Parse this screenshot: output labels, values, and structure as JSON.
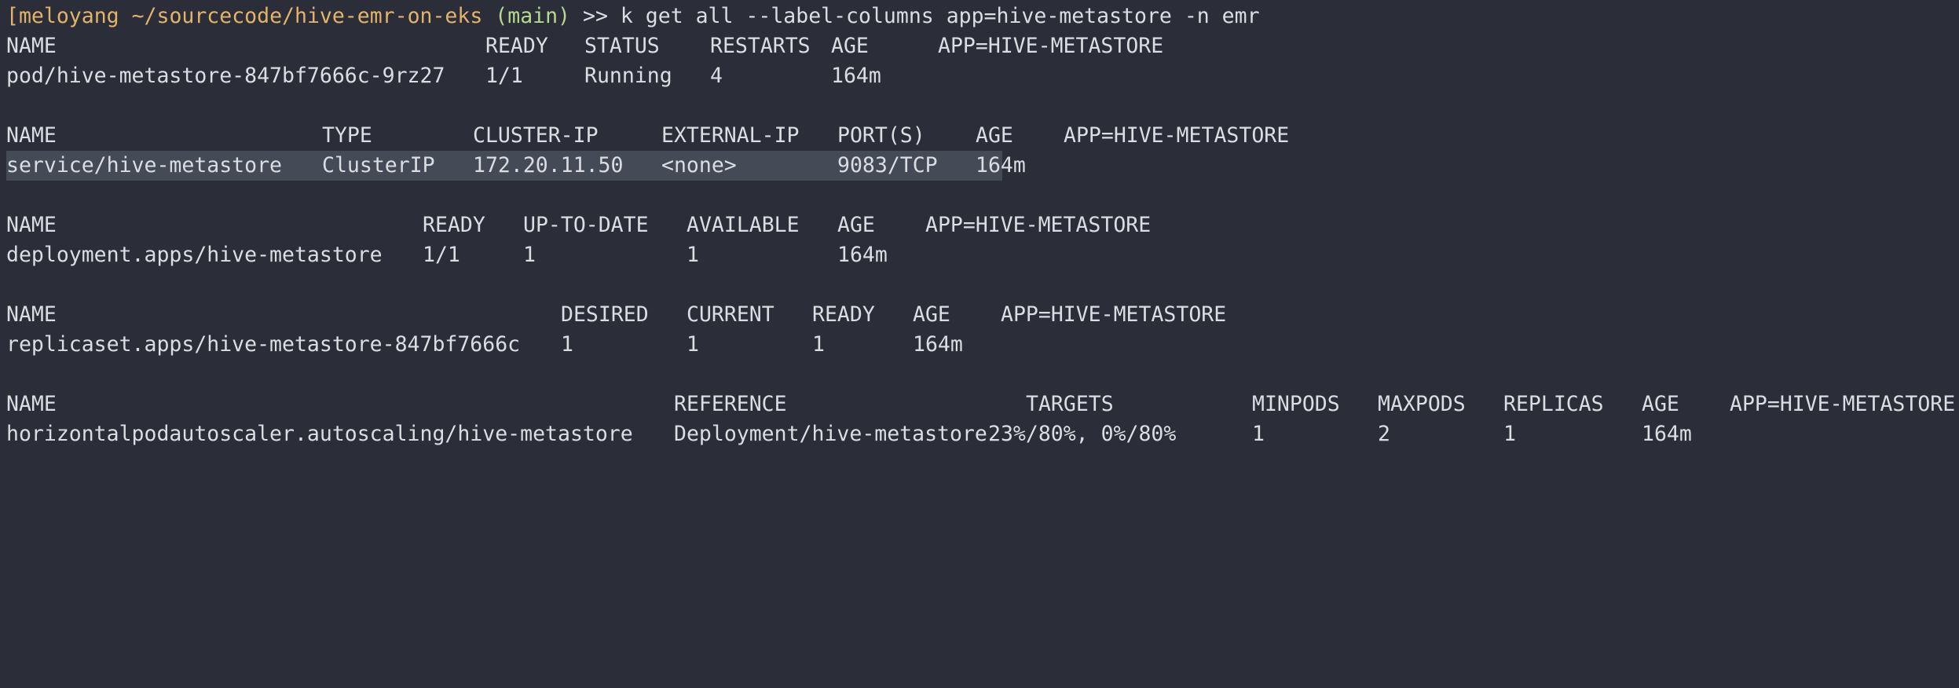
{
  "prompt": {
    "user": "meloyang",
    "path": "~/sourcecode/hive-emr-on-eks",
    "branch": "(main)",
    "arrow": ">>",
    "command": "k get all --label-columns app=hive-metastore -n emr"
  },
  "pods": {
    "headers": [
      "NAME",
      "READY",
      "STATUS",
      "RESTARTS",
      "AGE",
      "APP=HIVE-METASTORE"
    ],
    "row": [
      "pod/hive-metastore-847bf7666c-9rz27",
      "1/1",
      "Running",
      "4",
      "164m",
      ""
    ]
  },
  "services": {
    "headers": [
      "NAME",
      "TYPE",
      "CLUSTER-IP",
      "EXTERNAL-IP",
      "PORT(S)",
      "AGE",
      "APP=HIVE-METASTORE"
    ],
    "row": [
      "service/hive-metastore",
      "ClusterIP",
      "172.20.11.50",
      "<none>",
      "9083/TCP",
      "164m",
      ""
    ]
  },
  "deployments": {
    "headers": [
      "NAME",
      "READY",
      "UP-TO-DATE",
      "AVAILABLE",
      "AGE",
      "APP=HIVE-METASTORE"
    ],
    "row": [
      "deployment.apps/hive-metastore",
      "1/1",
      "1",
      "1",
      "164m",
      ""
    ]
  },
  "replicasets": {
    "headers": [
      "NAME",
      "DESIRED",
      "CURRENT",
      "READY",
      "AGE",
      "APP=HIVE-METASTORE"
    ],
    "row": [
      "replicaset.apps/hive-metastore-847bf7666c",
      "1",
      "1",
      "1",
      "164m",
      ""
    ]
  },
  "hpas": {
    "headers": [
      "NAME",
      "REFERENCE",
      "TARGETS",
      "MINPODS",
      "MAXPODS",
      "REPLICAS",
      "AGE",
      "APP=HIVE-METASTORE"
    ],
    "row": [
      "horizontalpodautoscaler.autoscaling/hive-metastore",
      "Deployment/hive-metastore",
      "23%/80%, 0%/80%",
      "1",
      "2",
      "1",
      "164m",
      ""
    ]
  }
}
